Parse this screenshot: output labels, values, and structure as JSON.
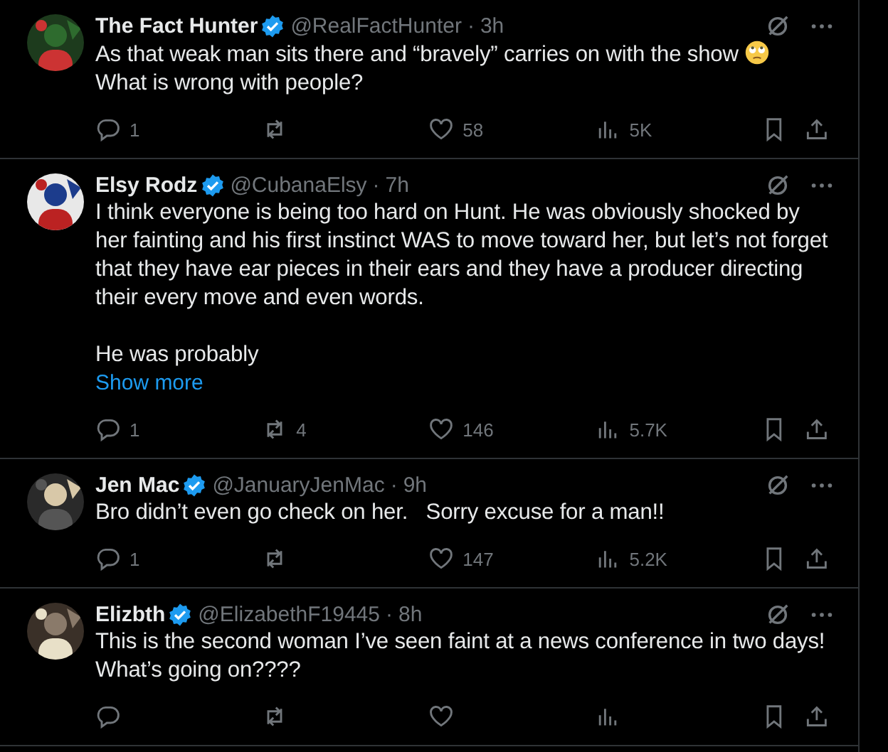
{
  "tweets": [
    {
      "name": "The Fact Hunter",
      "verified": true,
      "handle": "@RealFactHunter",
      "separator": "·",
      "time": "3h",
      "paragraphs": [
        {
          "lines": [
            {
              "text": "As that weak man sits there and “bravely” carries on with the show",
              "emoji": true
            },
            {
              "text": "What is wrong with people?"
            }
          ]
        }
      ],
      "stats": {
        "replies": "1",
        "likes": "58",
        "views": "5K"
      }
    },
    {
      "name": "Elsy Rodz",
      "verified": true,
      "handle": "@CubanaElsy",
      "separator": "·",
      "time": "7h",
      "paragraphs": [
        {
          "lines": [
            {
              "text": "I think everyone is being too hard on Hunt. He was obviously shocked by her fainting and his first instinct WAS to move toward her, but let’s not forget that they have ear pieces in their ears and they have a producer directing their every move and even words."
            }
          ]
        },
        {
          "lines": [
            {
              "text": "He was probably"
            }
          ]
        }
      ],
      "show_more": "Show more",
      "stats": {
        "replies": "1",
        "reposts": "4",
        "likes": "146",
        "views": "5.7K"
      }
    },
    {
      "name": "Jen Mac",
      "verified": true,
      "handle": "@JanuaryJenMac",
      "separator": "·",
      "time": "9h",
      "paragraphs": [
        {
          "lines": [
            {
              "text": "Bro didn’t even go check on her.   Sorry excuse for a man!!"
            }
          ]
        }
      ],
      "stats": {
        "replies": "1",
        "likes": "147",
        "views": "5.2K"
      }
    },
    {
      "name": "Elizbth",
      "verified": true,
      "handle": "@ElizabethF19445",
      "separator": "·",
      "time": "8h",
      "paragraphs": [
        {
          "lines": [
            {
              "text": "This is the second woman I’ve seen faint at a news conference in two days!"
            },
            {
              "text": "What’s going on????"
            }
          ]
        }
      ]
    }
  ]
}
